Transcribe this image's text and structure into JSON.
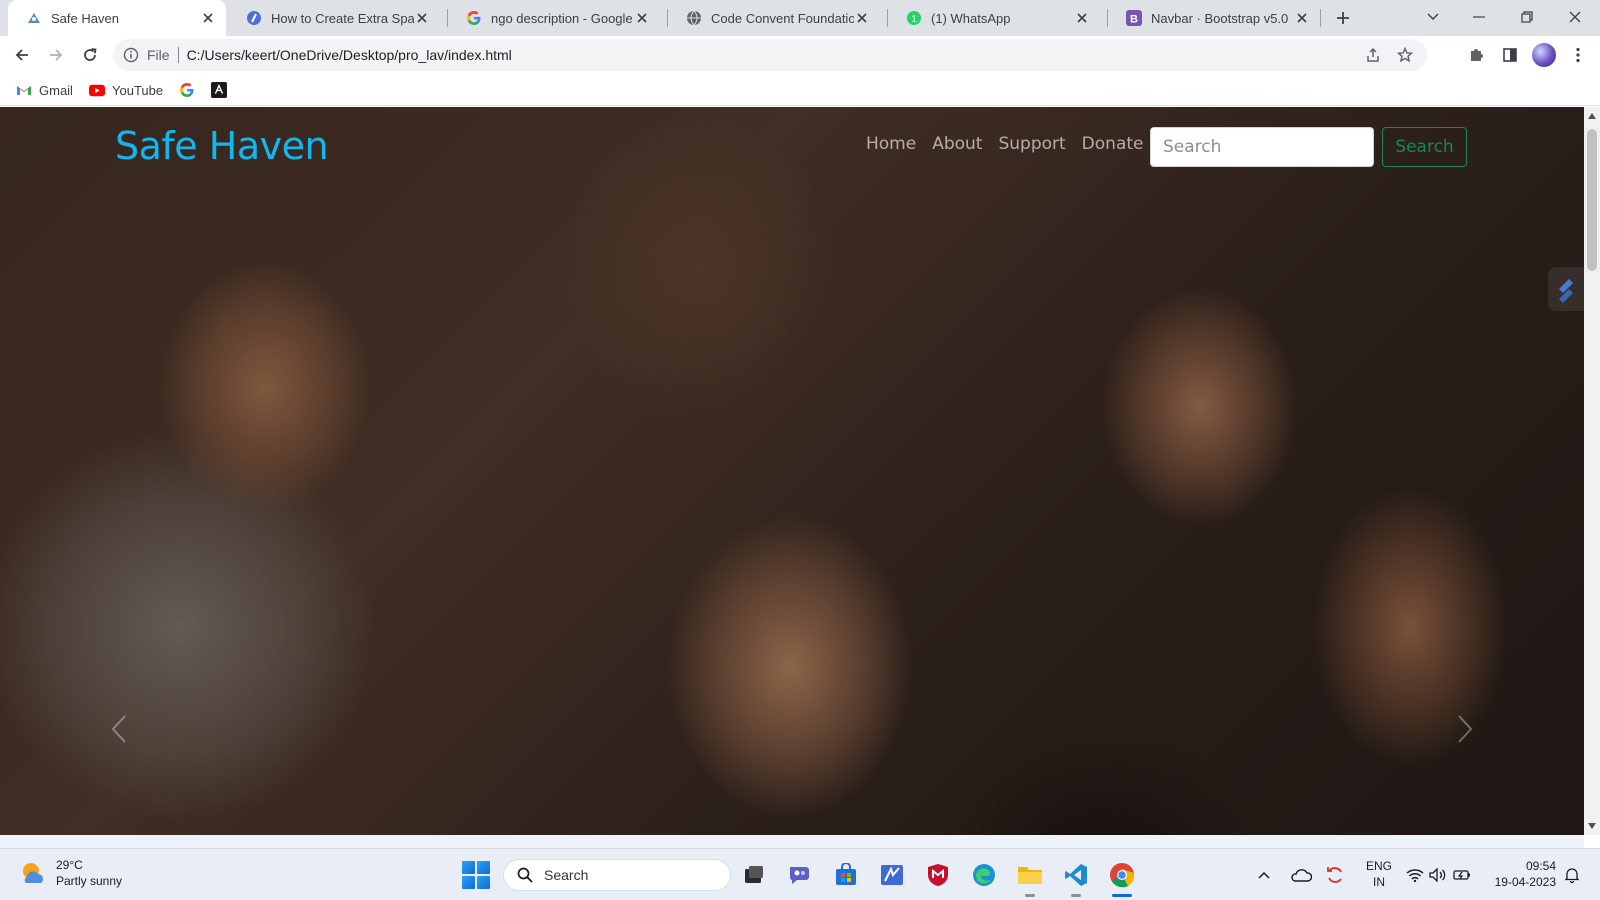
{
  "browser": {
    "tabs": [
      {
        "title": "Safe Haven",
        "favicon": "page-favicon",
        "active": true
      },
      {
        "title": "How to Create Extra Space I",
        "favicon": "stack-favicon",
        "active": false
      },
      {
        "title": "ngo description - Google Se",
        "favicon": "google-favicon",
        "active": false
      },
      {
        "title": "Code Convent Foundation",
        "favicon": "globe-favicon",
        "active": false
      },
      {
        "title": "(1) WhatsApp",
        "favicon": "whatsapp-favicon",
        "active": false
      },
      {
        "title": "Navbar · Bootstrap v5.0",
        "favicon": "bootstrap-favicon",
        "active": false
      }
    ],
    "address": {
      "scheme_label": "File",
      "url": "C:/Users/keert/OneDrive/Desktop/pro_lav/index.html"
    },
    "bookmarks": [
      {
        "label": "Gmail",
        "icon": "gmail-icon"
      },
      {
        "label": "YouTube",
        "icon": "youtube-icon"
      },
      {
        "label": "",
        "icon": "google-icon"
      },
      {
        "label": "",
        "icon": "bookmark-app-icon"
      }
    ]
  },
  "page": {
    "brand": "Safe Haven",
    "nav": [
      "Home",
      "About",
      "Support",
      "Donate"
    ],
    "search_placeholder": "Search",
    "search_button": "Search",
    "colors": {
      "brand": "#12b7f0",
      "search_button": "#198754"
    }
  },
  "taskbar": {
    "weather_temp": "29°C",
    "weather_desc": "Partly sunny",
    "search_label": "Search",
    "lang_primary": "ENG",
    "lang_secondary": "IN",
    "time": "09:54",
    "date": "19-04-2023",
    "apps": [
      "task-view-icon",
      "teams-chat-icon",
      "store-icon",
      "pen-app-icon",
      "mcafee-icon",
      "edge-icon",
      "file-explorer-icon",
      "vscode-icon",
      "chrome-icon"
    ]
  }
}
